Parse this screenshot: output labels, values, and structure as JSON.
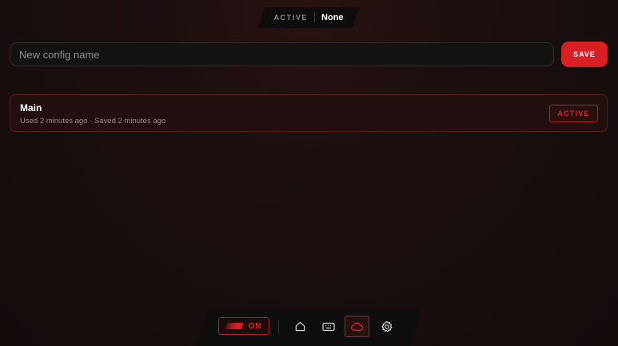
{
  "status": {
    "label": "ACTIVE",
    "value": "None"
  },
  "config_form": {
    "placeholder": "New config name",
    "save_label": "SAVE"
  },
  "configs": [
    {
      "name": "Main",
      "meta": "Used 2 minutes ago · Saved 2 minutes ago",
      "badge": "ACTIVE"
    }
  ],
  "dock": {
    "power_label": "ON",
    "items": [
      {
        "icon": "home-icon",
        "selected": false
      },
      {
        "icon": "keyboard-icon",
        "selected": false
      },
      {
        "icon": "cloud-icon",
        "selected": true
      },
      {
        "icon": "gear-icon",
        "selected": false
      }
    ]
  },
  "colors": {
    "accent": "#d91f24",
    "background": "#170d0d",
    "card_border": "#5a1c1c"
  }
}
